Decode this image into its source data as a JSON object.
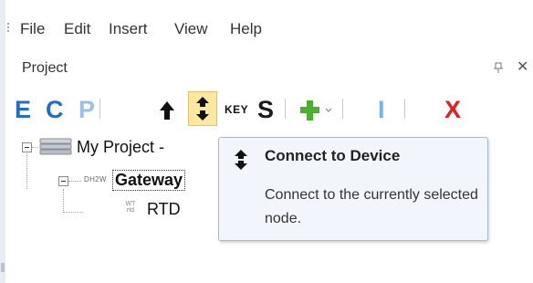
{
  "menu": {
    "items": [
      "File",
      "Edit",
      "Insert",
      "View",
      "Help"
    ]
  },
  "panel": {
    "title": "Project",
    "close_label": "✕"
  },
  "toolbar": {
    "e_label": "E",
    "c_label": "C",
    "p_label": "P",
    "key_label": "KEY",
    "s_label": "S",
    "i_label": "I",
    "x_label": "X",
    "colors": {
      "e": "#1f6fc9",
      "c": "#1f6fc9",
      "p": "#9bbfe6",
      "s": "#1a1a1a",
      "plus": "#4caf33",
      "i": "#6fb6ee",
      "x": "#e0201f"
    },
    "icons": [
      "e-icon",
      "c-icon",
      "p-icon",
      "up-arrow-icon",
      "connect-icon",
      "key-icon",
      "s-icon",
      "add-icon",
      "dropdown-chevron-icon",
      "i-icon",
      "delete-x-icon"
    ]
  },
  "tree": {
    "root_label": "My Project -",
    "gateway_tag": "DH2W",
    "gateway_label": "Gateway",
    "rtd_tag_top": "WT",
    "rtd_tag_bottom": "rtd",
    "rtd_label": "RTD"
  },
  "tooltip": {
    "title": "Connect to Device",
    "description": "Connect to the currently selected node."
  }
}
